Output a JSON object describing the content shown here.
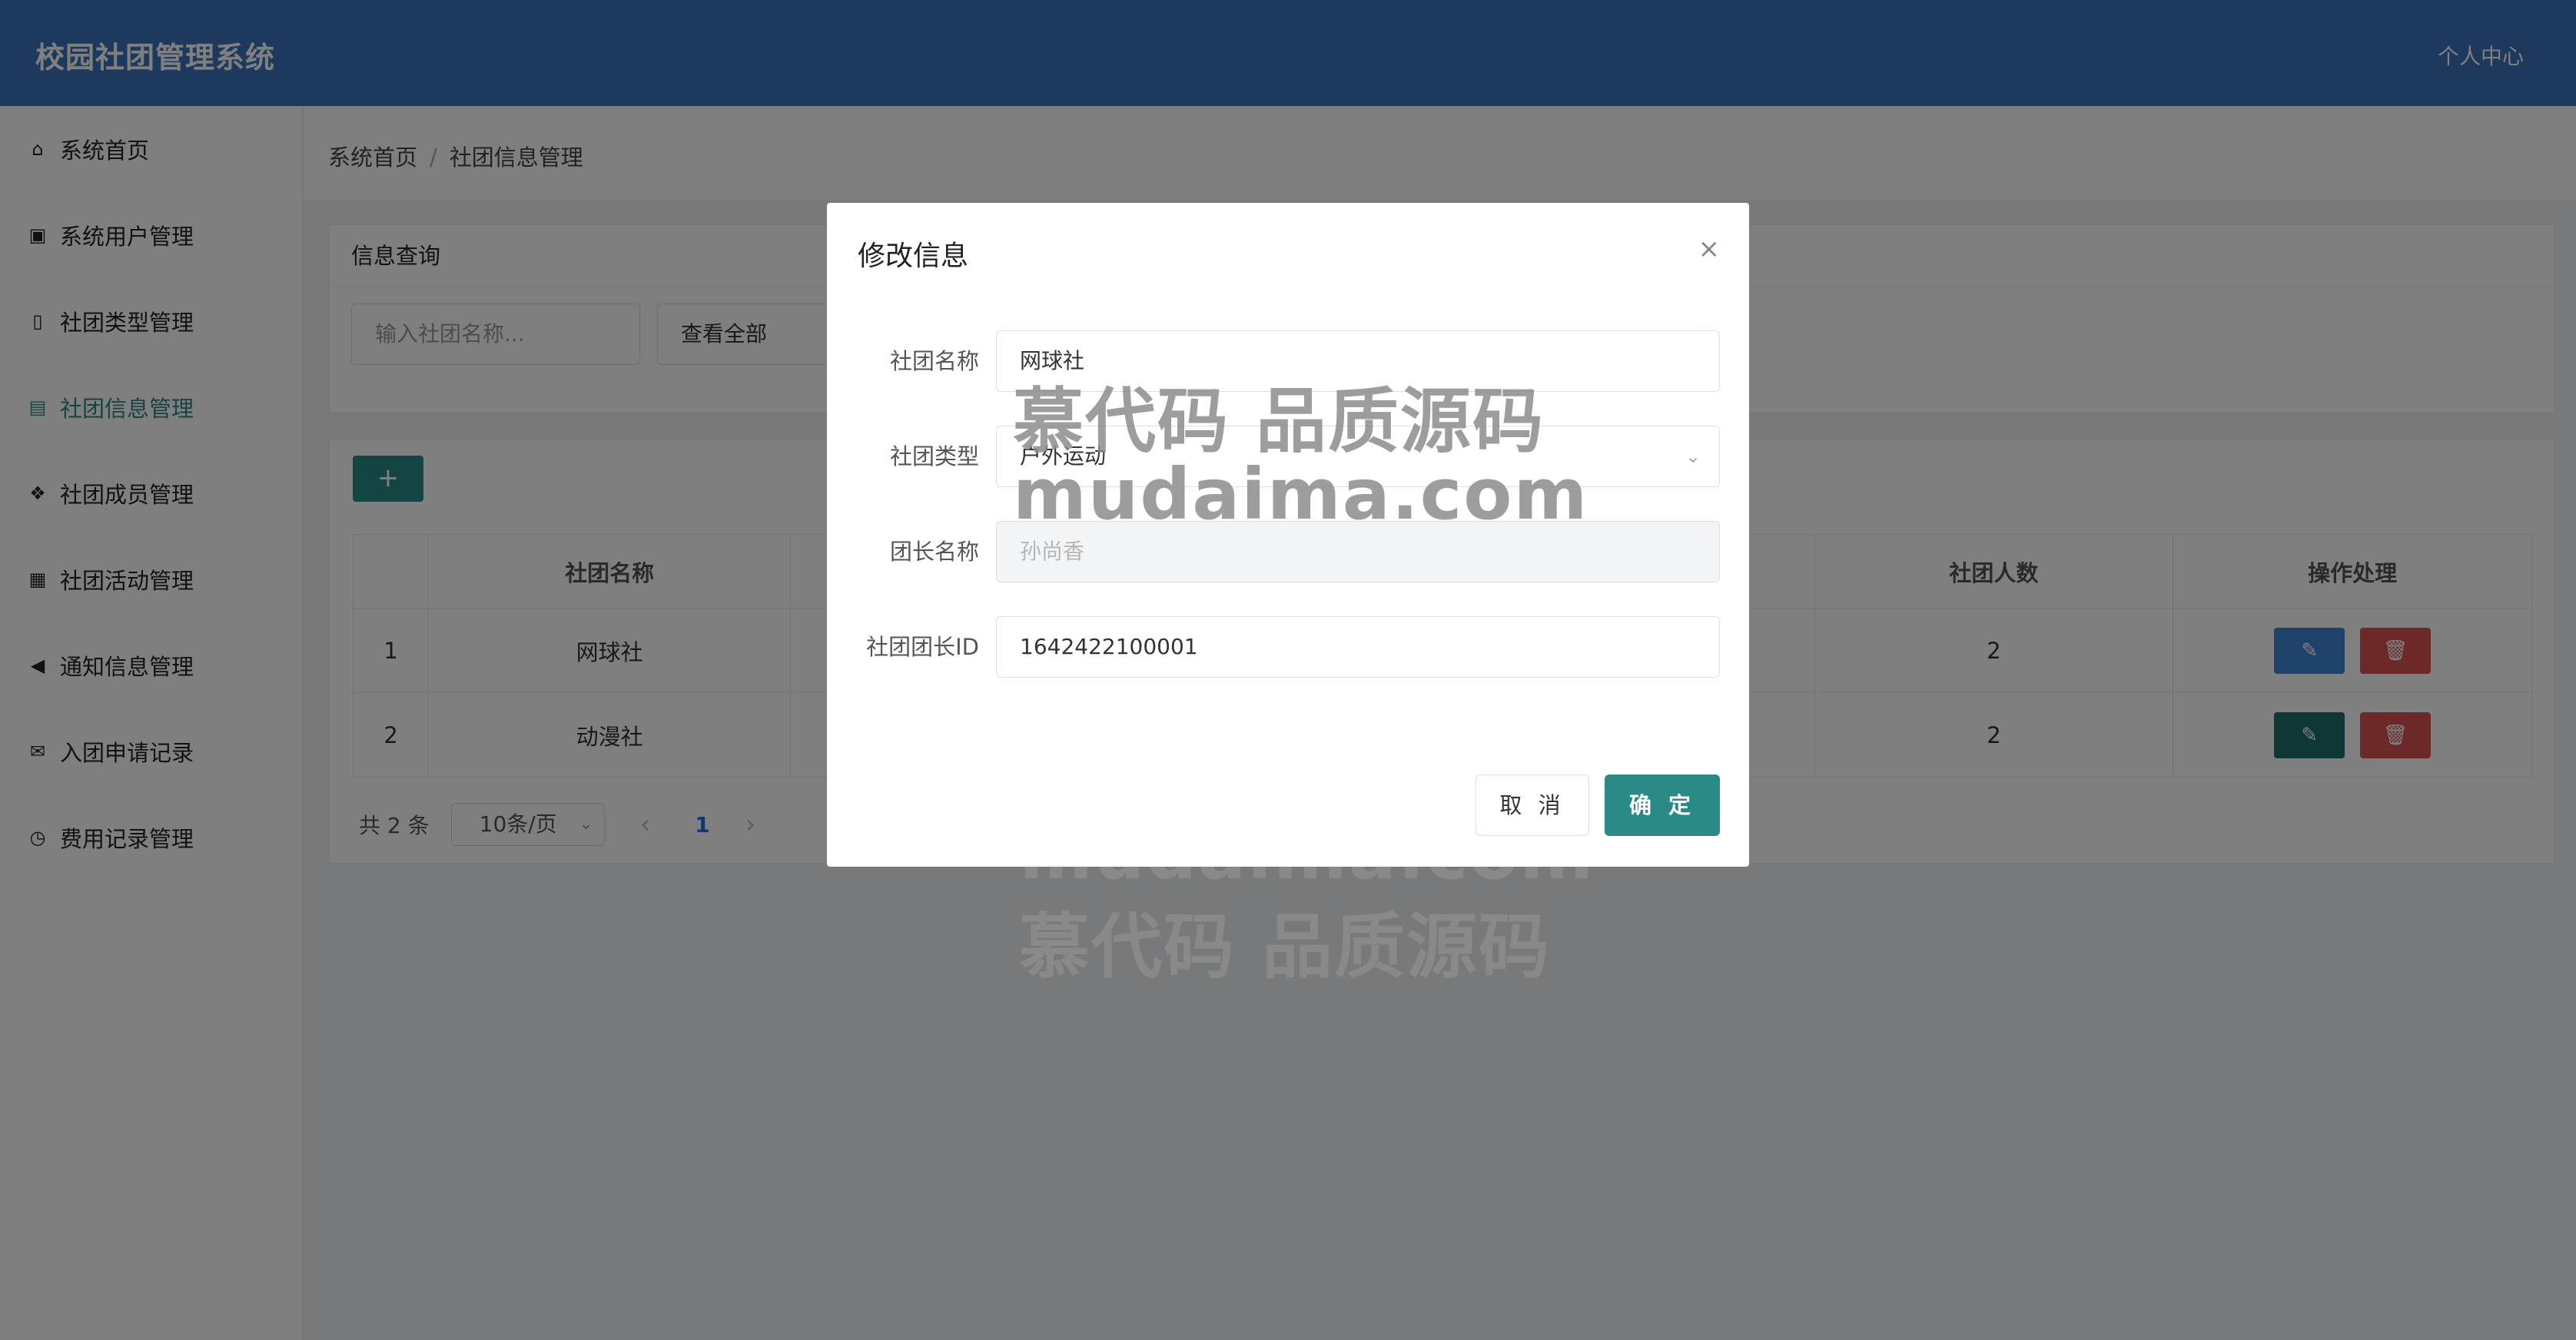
{
  "header": {
    "title": "校园社团管理系统",
    "user_center": "个人中心"
  },
  "sidebar": {
    "items": [
      {
        "label": "系统首页",
        "icon": "home-icon",
        "glyph": "⌂"
      },
      {
        "label": "系统用户管理",
        "icon": "user-card-icon",
        "glyph": "▣"
      },
      {
        "label": "社团类型管理",
        "icon": "tablet-icon",
        "glyph": "▯"
      },
      {
        "label": "社团信息管理",
        "icon": "train-icon",
        "glyph": "▤"
      },
      {
        "label": "社团成员管理",
        "icon": "cubes-icon",
        "glyph": "❖"
      },
      {
        "label": "社团活动管理",
        "icon": "calculator-icon",
        "glyph": "▦"
      },
      {
        "label": "通知信息管理",
        "icon": "megaphone-icon",
        "glyph": "◀"
      },
      {
        "label": "入团申请记录",
        "icon": "envelope-open-icon",
        "glyph": "✉"
      },
      {
        "label": "费用记录管理",
        "icon": "clock-icon",
        "glyph": "◷"
      }
    ],
    "active_index": 3,
    "active_color": "#2a8a86"
  },
  "breadcrumb": {
    "home": "系统首页",
    "current": "社团信息管理"
  },
  "query": {
    "title": "信息查询",
    "search_placeholder": "输入社团名称...",
    "view_all": "查看全部"
  },
  "table": {
    "add_label": "+",
    "headers": {
      "name": "社团名称",
      "members": "社团人数",
      "actions": "操作处理"
    },
    "rows": [
      {
        "index": "1",
        "name": "网球社",
        "members": "2"
      },
      {
        "index": "2",
        "name": "动漫社",
        "members": "2"
      }
    ]
  },
  "pagination": {
    "total": "共 2 条",
    "page_size": "10条/页",
    "current_page": "1"
  },
  "modal": {
    "title": "修改信息",
    "fields": {
      "name_label": "社团名称",
      "name_value": "网球社",
      "type_label": "社团类型",
      "type_value": "户外运动",
      "leader_label": "团长名称",
      "leader_value": "孙尚香",
      "leader_id_label": "社团团长ID",
      "leader_id_value": "1642422100001"
    },
    "cancel": "取 消",
    "confirm": "确 定"
  },
  "watermark": {
    "line1": "慕代码 品质源码",
    "line2": "mudaima.com"
  },
  "colors": {
    "header": "#3b73bb",
    "accent": "#2a8a86",
    "edit": "#3f84d6",
    "delete": "#d9534f"
  }
}
